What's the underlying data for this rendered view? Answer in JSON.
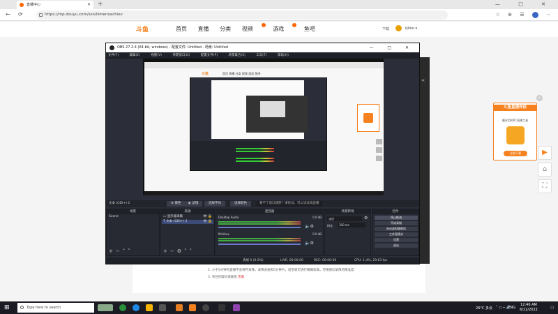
{
  "browser": {
    "tab_title": "直播中心",
    "new_tab": "+",
    "url": "https://mp.douyu.com/sso/liimenoachiev",
    "window_controls": [
      "—",
      "□",
      "✕"
    ],
    "nav_back": "←",
    "nav_refresh": "⟳",
    "nav_icons": [
      "☆",
      "⊕",
      "☰",
      "⋯"
    ]
  },
  "site": {
    "logo": "斗鱼",
    "nav": [
      "首页",
      "直播",
      "分类",
      "视频",
      "游戏",
      "鱼吧"
    ],
    "download": "下载",
    "username": "lyhko"
  },
  "obs": {
    "title": "OBS 27.2.4 (64-bit, windows) - 配置文件: Untitled - 场景: Untitled",
    "menu": [
      "文件(F)",
      "编辑(E)",
      "视图(V)",
      "停靠窗口(D)",
      "配置文件(P)",
      "场景集合(S)",
      "工具(T)",
      "帮助(H)"
    ],
    "preview_logo": "斗鱼",
    "preview_nav": "首页 直播 分类 视频 游戏 鱼吧",
    "source_label": "文本 (GDI+) 2",
    "source_buttons": [
      "属性",
      "滤镜",
      "选择字体",
      "选择颜色"
    ],
    "hint": "看不了窗口捕获？请尝试。可以试试再直播",
    "docks": {
      "scenes": {
        "title": "场景",
        "items": [
          "Scene"
        ]
      },
      "sources": {
        "title": "来源",
        "items": [
          "显示器采集",
          "文本 (GDI+) 2"
        ]
      },
      "mixer": {
        "title": "混音器",
        "tracks": [
          {
            "name": "Desktop Audio",
            "db": "0.0 dB"
          },
          {
            "name": "Mic/Aux",
            "db": "0.0 dB"
          }
        ]
      },
      "transitions": {
        "title": "场景转场",
        "type": "淡出",
        "duration_label": "时长",
        "duration": "300 ms"
      },
      "controls": {
        "title": "控件",
        "buttons": [
          "停止推流",
          "开始录制",
          "启动虚拟摄像机",
          "工作室模式",
          "设置",
          "退出"
        ]
      }
    },
    "status": {
      "dropped": "丢帧 0 (0.0%)",
      "live": "LIVE: 00:00:00",
      "rec": "REC: 00:00:00",
      "cpu": "CPU: 1.4%, 29.63 fps"
    }
  },
  "page": {
    "lines": [
      "2. 小于5分钟的直播不会保存录像，录像会按照5分钟片，前后帧可进行精确剪辑，可拖拽切录像的精准度",
      "3. 有任何疑问请联系"
    ],
    "contact_link": "客服"
  },
  "ad": {
    "title": "斗鱼直播伴侣",
    "subtitle": "最好用的PC直播工具",
    "button": "立即下载",
    "close": "×"
  },
  "side_buttons": [
    "▶",
    "⌂",
    "⛶"
  ],
  "taskbar": {
    "search_placeholder": "Type here to search",
    "weather": "26°C 多云",
    "time": "12:46 AM",
    "date": "6/22/2022",
    "lang": "ENG"
  },
  "colors": {
    "brand": "#f5821f",
    "obs_bg": "#2b2e38",
    "taskbar": "#1b1b24"
  }
}
